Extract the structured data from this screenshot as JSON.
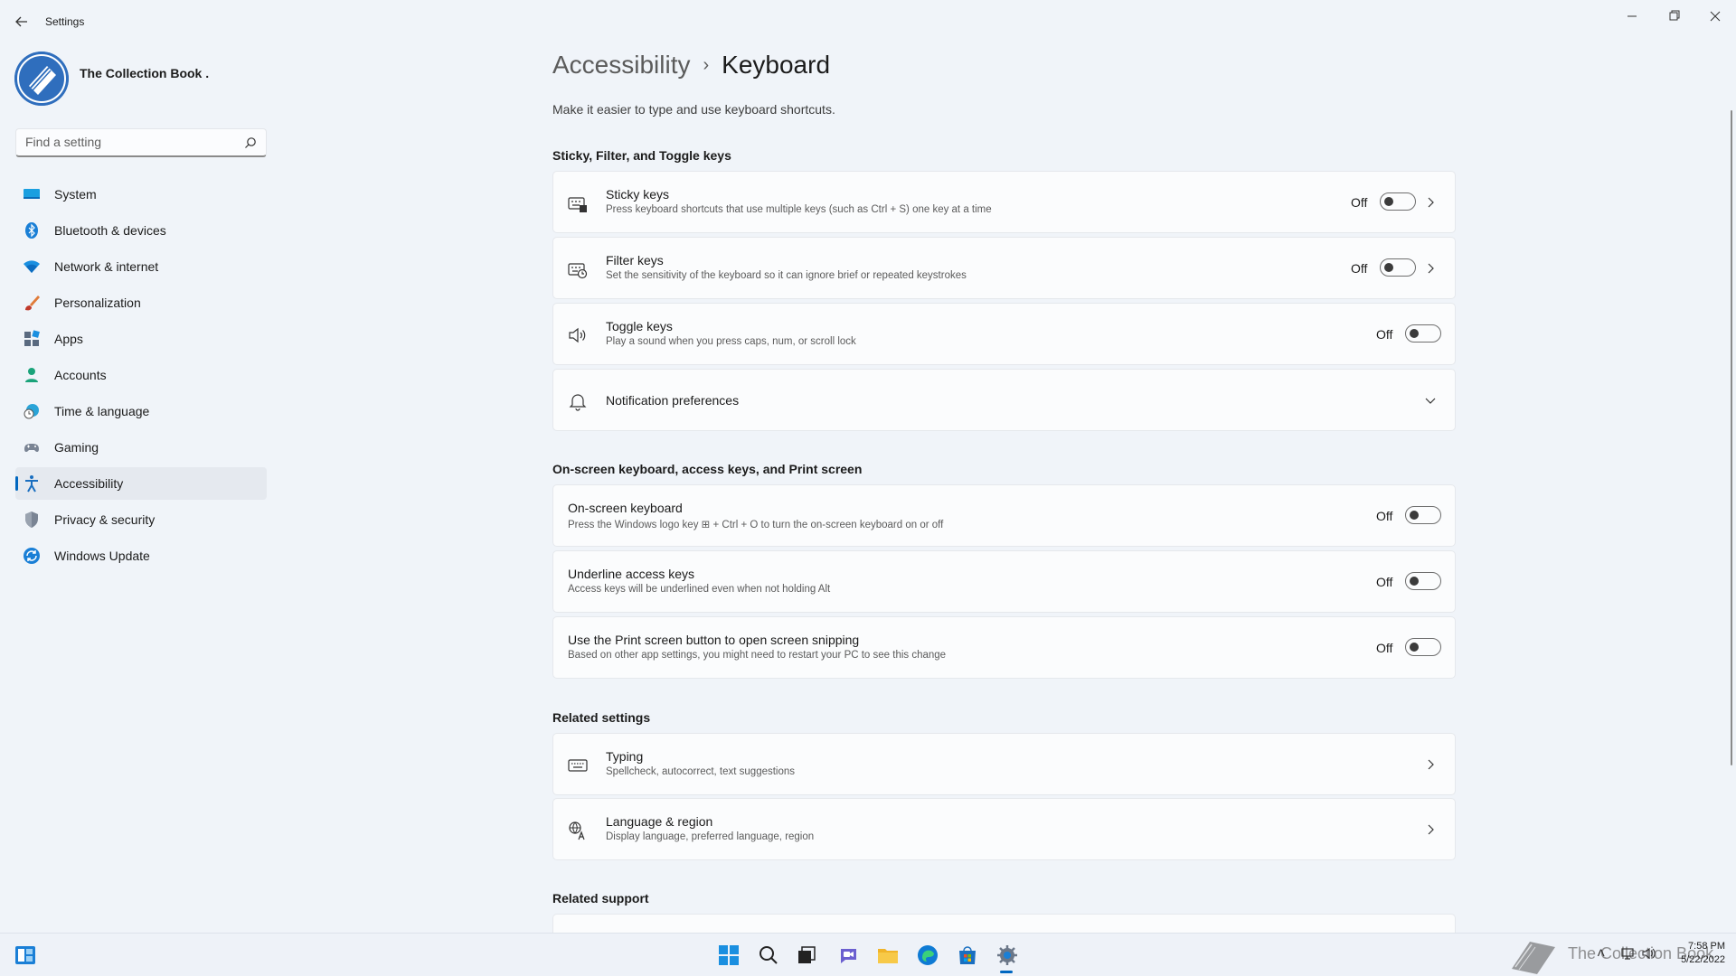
{
  "window": {
    "title": "Settings"
  },
  "profile": {
    "name": "The Collection Book ."
  },
  "search": {
    "placeholder": "Find a setting"
  },
  "sidebar": {
    "items": [
      {
        "label": "System",
        "icon": "monitor-icon"
      },
      {
        "label": "Bluetooth & devices",
        "icon": "bluetooth-icon"
      },
      {
        "label": "Network & internet",
        "icon": "wifi-icon"
      },
      {
        "label": "Personalization",
        "icon": "brush-icon"
      },
      {
        "label": "Apps",
        "icon": "apps-icon"
      },
      {
        "label": "Accounts",
        "icon": "person-icon"
      },
      {
        "label": "Time & language",
        "icon": "globe-clock-icon"
      },
      {
        "label": "Gaming",
        "icon": "gamepad-icon"
      },
      {
        "label": "Accessibility",
        "icon": "accessibility-icon",
        "active": true
      },
      {
        "label": "Privacy & security",
        "icon": "shield-icon"
      },
      {
        "label": "Windows Update",
        "icon": "update-icon"
      }
    ]
  },
  "header": {
    "parent": "Accessibility",
    "separator": "›",
    "current": "Keyboard",
    "description": "Make it easier to type and use keyboard shortcuts."
  },
  "sections": {
    "sticky": {
      "title": "Sticky, Filter, and Toggle keys",
      "cards": [
        {
          "title": "Sticky keys",
          "sub": "Press keyboard shortcuts that use multiple keys (such as Ctrl + S) one key at a time",
          "state": "Off",
          "icon": "sticky-keys-icon"
        },
        {
          "title": "Filter keys",
          "sub": "Set the sensitivity of the keyboard so it can ignore brief or repeated keystrokes",
          "state": "Off",
          "icon": "filter-keys-icon"
        },
        {
          "title": "Toggle keys",
          "sub": "Play a sound when you press caps, num, or scroll lock",
          "state": "Off",
          "icon": "speaker-icon"
        },
        {
          "title": "Notification preferences",
          "icon": "bell-icon"
        }
      ]
    },
    "onscreen": {
      "title": "On-screen keyboard, access keys, and Print screen",
      "cards": [
        {
          "title": "On-screen keyboard",
          "sub": "Press the Windows logo key ⊞ + Ctrl + O to turn the on-screen keyboard on or off",
          "state": "Off"
        },
        {
          "title": "Underline access keys",
          "sub": "Access keys will be underlined even when not holding Alt",
          "state": "Off"
        },
        {
          "title": "Use the Print screen button to open screen snipping",
          "sub": "Based on other app settings, you might need to restart your PC to see this change",
          "state": "Off"
        }
      ]
    },
    "related": {
      "title": "Related settings",
      "cards": [
        {
          "title": "Typing",
          "sub": "Spellcheck, autocorrect, text suggestions",
          "icon": "keyboard-icon"
        },
        {
          "title": "Language & region",
          "sub": "Display language, preferred language, region",
          "icon": "language-icon"
        }
      ]
    },
    "support": {
      "title": "Related support"
    }
  },
  "taskbar": {
    "clock_time": "7:58 PM",
    "clock_date": "5/22/2022",
    "watermark": "The Collection Book"
  },
  "colors": {
    "accent": "#0067c0",
    "background": "#f0f4f9",
    "card": "#fbfcfd"
  }
}
